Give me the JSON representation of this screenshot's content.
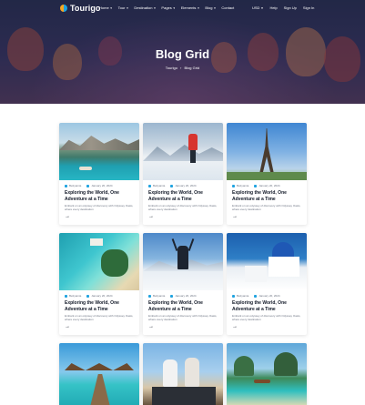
{
  "brand": {
    "name": "Tourigo"
  },
  "nav": {
    "items": [
      {
        "label": "Home",
        "caret": true
      },
      {
        "label": "Tour",
        "caret": true
      },
      {
        "label": "Destination",
        "caret": true
      },
      {
        "label": "Pages",
        "caret": true
      },
      {
        "label": "Elements",
        "caret": true
      },
      {
        "label": "Blog",
        "caret": true
      },
      {
        "label": "Contact",
        "caret": false
      }
    ],
    "right": [
      {
        "label": "USD",
        "caret": true
      },
      {
        "label": "Help",
        "caret": false
      },
      {
        "label": "Sign Up",
        "caret": false
      },
      {
        "label": "Sign In",
        "caret": false
      }
    ]
  },
  "hero": {
    "title": "Blog Grid",
    "breadcrumb": [
      "Tourigo",
      "Blog Grid"
    ],
    "breadcrumb_separator": "›"
  },
  "cards": [
    {
      "image": "lake-mountains",
      "author": "Bettyamia",
      "date": "January 20, 2024",
      "title": "Exploring the World, One Adventure at a Time",
      "excerpt": "Embark on an odyssey of discovery with Odyssey Oasis, where every destination",
      "arrow": "→"
    },
    {
      "image": "snow-hiker",
      "author": "Bettyamia",
      "date": "January 20, 2024",
      "title": "Exploring the World, One Adventure at a Time",
      "excerpt": "Embark on an odyssey of discovery with Odyssey Oasis, where every destination",
      "arrow": "→"
    },
    {
      "image": "eiffel-tower",
      "author": "Bettyamia",
      "date": "January 20, 2024",
      "title": "Exploring the World, One Adventure at a Time",
      "excerpt": "Embark on an odyssey of discovery with Odyssey Oasis, where every destination",
      "arrow": "→"
    },
    {
      "image": "aerial-resort",
      "author": "Bettyamia",
      "date": "January 20, 2024",
      "title": "Exploring the World, One Adventure at a Time",
      "excerpt": "Embark on an odyssey of discovery with Odyssey Oasis, where every destination",
      "arrow": "→"
    },
    {
      "image": "ski-peak",
      "author": "Bettyamia",
      "date": "January 20, 2024",
      "title": "Exploring the World, One Adventure at a Time",
      "excerpt": "Embark on an odyssey of discovery with Odyssey Oasis, where every destination",
      "arrow": "→"
    },
    {
      "image": "santorini",
      "author": "Bettyamia",
      "date": "January 20, 2024",
      "title": "Exploring the World, One Adventure at a Time",
      "excerpt": "Embark on an odyssey of discovery with Odyssey Oasis, where every destination",
      "arrow": "→"
    },
    {
      "image": "overwater-bungalows",
      "author": "",
      "date": "",
      "title": "",
      "excerpt": "",
      "arrow": ""
    },
    {
      "image": "happy-couple",
      "author": "",
      "date": "",
      "title": "",
      "excerpt": "",
      "arrow": ""
    },
    {
      "image": "tropical-beach",
      "author": "",
      "date": "",
      "title": "",
      "excerpt": "",
      "arrow": ""
    }
  ]
}
